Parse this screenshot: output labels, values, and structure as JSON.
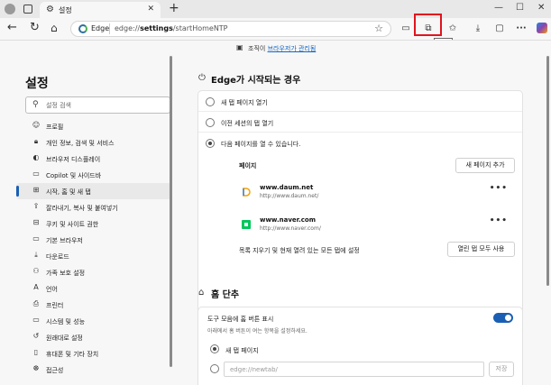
{
  "browser": {
    "tab_title": "설정",
    "tab_close": "✕",
    "new_tab": "+",
    "window_controls": [
      "—",
      "☐",
      "✕"
    ]
  },
  "address_bar": {
    "site_label": "Edge",
    "url_prefix": "edge://",
    "url_bold": "settings",
    "url_suffix": "/startHomeNTP"
  },
  "toolbar": {
    "extensions_tooltip": "확장",
    "highlight_color": "#e0141e"
  },
  "infobar": {
    "text_before": "조직이",
    "link": "브라우저가 관리됨"
  },
  "sidebar": {
    "title": "설정",
    "search_placeholder": "설정 검색",
    "items": [
      {
        "icon": "profile-icon",
        "label": "프로필"
      },
      {
        "icon": "lock-icon",
        "label": "개인 정보, 검색 및 서비스"
      },
      {
        "icon": "appearance-icon",
        "label": "브라우저 디스플레이"
      },
      {
        "icon": "copilot-icon",
        "label": "Copilot 및 사이드바"
      },
      {
        "icon": "home-tab-icon",
        "label": "시작, 홈 및 새 탭",
        "active": true
      },
      {
        "icon": "share-icon",
        "label": "잘라내기, 복사 및 붙여넣기"
      },
      {
        "icon": "cookie-icon",
        "label": "쿠키 및 사이트 권한"
      },
      {
        "icon": "browser-icon",
        "label": "기본 브라우저"
      },
      {
        "icon": "download-icon",
        "label": "다운로드"
      },
      {
        "icon": "family-icon",
        "label": "가족 보호 설정"
      },
      {
        "icon": "language-icon",
        "label": "언어"
      },
      {
        "icon": "printer-icon",
        "label": "프린터"
      },
      {
        "icon": "system-icon",
        "label": "시스템 및 성능"
      },
      {
        "icon": "reset-icon",
        "label": "원래대로 설정"
      },
      {
        "icon": "phone-icon",
        "label": "휴대폰 및 기타 장치"
      },
      {
        "icon": "accessibility-icon",
        "label": "접근성"
      }
    ]
  },
  "startup": {
    "title": "Edge가 시작되는 경우",
    "options": [
      {
        "label": "새 탭 페이지 열기",
        "selected": false
      },
      {
        "label": "이전 세션의 탭 열기",
        "selected": false
      },
      {
        "label": "다음 페이지를 열 수 있습니다.",
        "selected": true
      }
    ],
    "pages_label": "페이지",
    "add_page_button": "새 페이지 추가",
    "sites": [
      {
        "name": "www.daum.net",
        "url": "http://www.daum.net/",
        "more": "•••"
      },
      {
        "name": "www.naver.com",
        "url": "http://www.naver.com/",
        "more": "•••"
      }
    ],
    "clear_label": "목록 지우기 및 현재 열려 있는 모든 탭에 설정",
    "use_open_tabs_button": "열린 탭 모두 사용"
  },
  "home": {
    "title": "홈 단추",
    "show_button_label": "도구 모음에 홈 버튼 표시",
    "show_button_desc": "아래에서 홈 버튼이 여는 항목을 설정하세요.",
    "toggle_on": true,
    "accent": "#1a5fb4",
    "options": [
      {
        "label": "새 탭 페이지",
        "selected": true
      }
    ],
    "url_placeholder": "edge://newtab/",
    "save_button": "저장"
  }
}
